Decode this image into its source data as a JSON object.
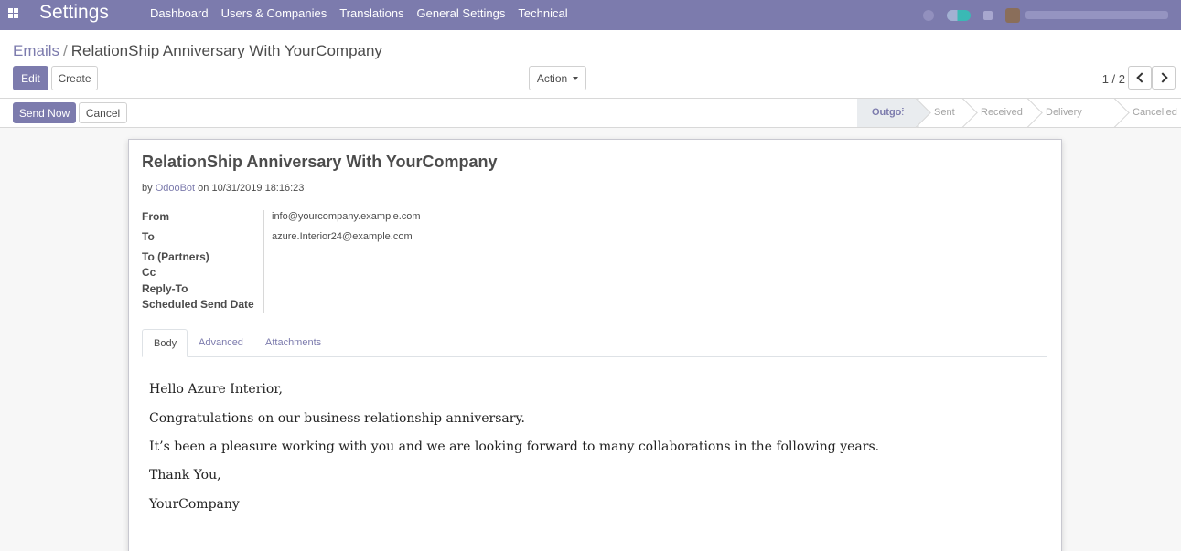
{
  "navbar": {
    "brand": "Settings",
    "menu": [
      "Dashboard",
      "Users & Companies",
      "Translations",
      "General Settings",
      "Technical"
    ]
  },
  "breadcrumb": {
    "parent": "Emails",
    "separator": "/",
    "current": "RelationShip Anniversary With YourCompany"
  },
  "buttons": {
    "edit": "Edit",
    "create": "Create",
    "action": "Action",
    "send_now": "Send Now",
    "cancel": "Cancel"
  },
  "pager": {
    "value": "1 / 2"
  },
  "stages": [
    "Outgoing",
    "Sent",
    "Received",
    "Delivery Failed",
    "Cancelled"
  ],
  "active_stage": "Outgoing",
  "mail": {
    "subject": "RelationShip Anniversary With YourCompany",
    "by_prefix": "by",
    "author": "OdooBot",
    "on_date": "on 10/31/2019 18:16:23",
    "fields": {
      "from_label": "From",
      "from_value": "info@yourcompany.example.com",
      "to_label": "To",
      "to_value": "azure.Interior24@example.com",
      "to_partners_label": "To (Partners)",
      "cc_label": "Cc",
      "reply_to_label": "Reply-To",
      "scheduled_label": "Scheduled Send Date"
    }
  },
  "tabs": [
    "Body",
    "Advanced",
    "Attachments"
  ],
  "body": [
    "Hello Azure Interior,",
    "Congratulations on our business relationship anniversary.",
    "It’s been a pleasure working with you and we are looking forward to many collaborations in the following years.",
    "Thank You,",
    "YourCompany"
  ],
  "colors": {
    "brand": "#7c7bad",
    "text": "#4c4c4c"
  }
}
